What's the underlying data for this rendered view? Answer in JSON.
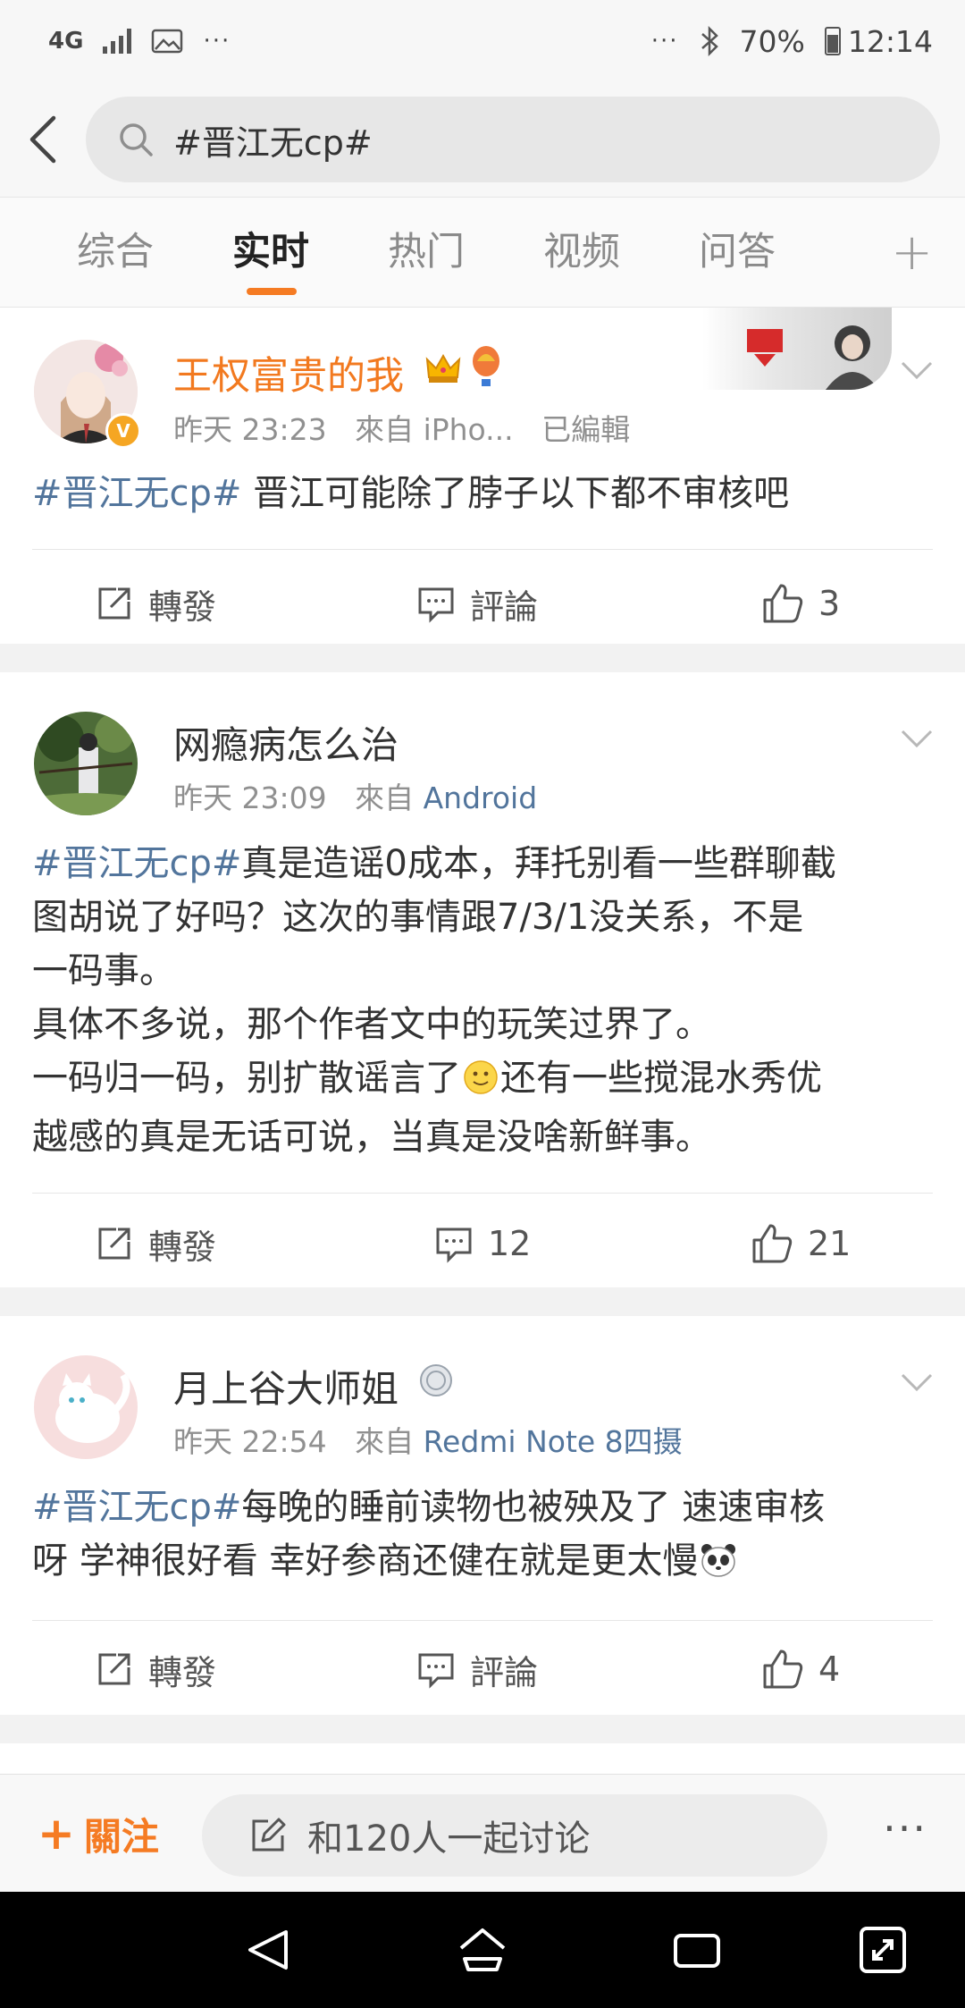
{
  "status_bar": {
    "network": "4G",
    "battery": "70%",
    "time": "12:14"
  },
  "search": {
    "query": "#晋江无cp#"
  },
  "tabs": [
    "综合",
    "实时",
    "热门",
    "视频",
    "问答"
  ],
  "active_tab": "实时",
  "posts": [
    {
      "username": "王权富贵的我",
      "time": "昨天 23:23",
      "source_prefix": "來自",
      "source": "iPho...",
      "edited": "已編輯",
      "hashtag": "#晋江无cp#",
      "text": " 晋江可能除了脖子以下都不审核吧",
      "repost_label": "轉發",
      "comment_label": "評論",
      "like_count": "3"
    },
    {
      "username": "网瘾病怎么治",
      "time": "昨天 23:09",
      "source_prefix": "來自",
      "source": "Android",
      "hashtag": "#晋江无cp#",
      "text_lines": [
        "真是造谣0成本，拜托别看一些群聊截",
        "图胡说了好吗？这次的事情跟7/3/1没关系，不是",
        "一码事。",
        "具体不多说，那个作者文中的玩笑过界了。",
        "一码归一码，别扩散谣言了",
        "还有一些搅混水秀优",
        "越感的真是无话可说，当真是没啥新鲜事。"
      ],
      "repost_label": "轉發",
      "comment_count": "12",
      "like_count": "21"
    },
    {
      "username": "月上谷大师姐",
      "time": "昨天 22:54",
      "source_prefix": "來自",
      "source": "Redmi Note 8四摄",
      "hashtag": "#晋江无cp#",
      "text_line1": "每晚的睡前读物也被殃及了 速速审核",
      "text_line2": "呀 学神很好看 幸好参商还健在就是更太慢",
      "repost_label": "轉發",
      "comment_label": "評論",
      "like_count": "4"
    }
  ],
  "bottom_bar": {
    "follow_label": "關注",
    "discuss_label": "和120人一起讨论"
  },
  "colors": {
    "accent": "#f57b23",
    "link": "#52759c",
    "vip_name": "#f2791f"
  }
}
